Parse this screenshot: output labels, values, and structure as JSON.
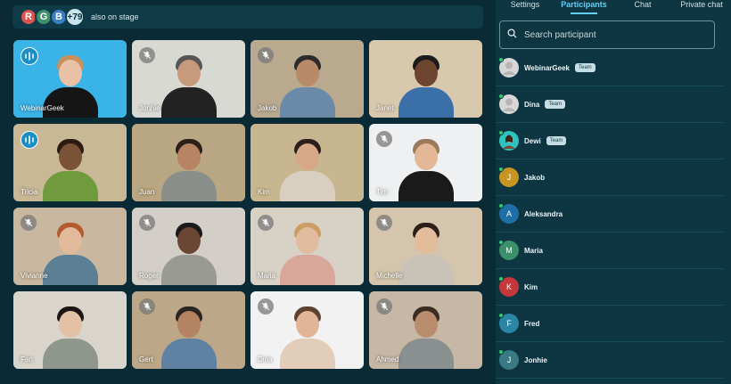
{
  "stage": {
    "avatars": [
      {
        "letter": "R",
        "color": "#d9534f"
      },
      {
        "letter": "G",
        "color": "#3f8f6a"
      },
      {
        "letter": "B",
        "color": "#3a7fc4"
      }
    ],
    "count": "+79",
    "label": "also on stage"
  },
  "tiles": [
    {
      "name": "WebinarGeek",
      "status": "speaking",
      "active": true,
      "bg": "#3ab3e6",
      "skin": "#e9c1a4",
      "hair": "#c7905d",
      "shirt": "#151515"
    },
    {
      "name": "Jonhie",
      "status": "muted",
      "active": false,
      "bg": "#d9d9d4",
      "skin": "#c89a7c",
      "hair": "#555555",
      "shirt": "#222222"
    },
    {
      "name": "Jakob",
      "status": "muted",
      "active": false,
      "bg": "#b8a98f",
      "skin": "#b98a68",
      "hair": "#2b2b2b",
      "shirt": "#6b8aa8"
    },
    {
      "name": "Janet",
      "status": "none",
      "active": false,
      "bg": "#d8c8ae",
      "skin": "#6e4630",
      "hair": "#1b1b1b",
      "shirt": "#3b6fa8"
    },
    {
      "name": "Tricia",
      "status": "speaking",
      "active": true,
      "bg": "#c9b896",
      "skin": "#7a5237",
      "hair": "#2a1c12",
      "shirt": "#6f9b3c"
    },
    {
      "name": "Juan",
      "status": "none",
      "active": false,
      "bg": "#b9a682",
      "skin": "#b88564",
      "hair": "#2a2118",
      "shirt": "#8a8f8c"
    },
    {
      "name": "Kim",
      "status": "none",
      "active": false,
      "bg": "#c8b690",
      "skin": "#d7a886",
      "hair": "#2a1f1a",
      "shirt": "#d9cfc0"
    },
    {
      "name": "Tim",
      "status": "muted",
      "active": false,
      "bg": "#eef0f1",
      "skin": "#e4b897",
      "hair": "#9a7a5a",
      "shirt": "#1a1a1a"
    },
    {
      "name": "Vivianne",
      "status": "muted",
      "active": false,
      "bg": "#c9b7a0",
      "skin": "#e2b99b",
      "hair": "#b35b2f",
      "shirt": "#5d7f96"
    },
    {
      "name": "Roger",
      "status": "muted",
      "active": false,
      "bg": "#d3cfc8",
      "skin": "#6a4634",
      "hair": "#1a1a1a",
      "shirt": "#9a9a95"
    },
    {
      "name": "Maria",
      "status": "muted",
      "active": false,
      "bg": "#d8d2c6",
      "skin": "#e2bc9f",
      "hair": "#c99d63",
      "shirt": "#d9a79a"
    },
    {
      "name": "Michelle",
      "status": "muted",
      "active": false,
      "bg": "#d4c5ac",
      "skin": "#e3bc9c",
      "hair": "#2b2018",
      "shirt": "#c9c2b7"
    },
    {
      "name": "Fan",
      "status": "none",
      "active": true,
      "bg": "#d9d4cc",
      "skin": "#e4c0a4",
      "hair": "#1b1614",
      "shirt": "#8f978d"
    },
    {
      "name": "Gert",
      "status": "muted",
      "active": false,
      "bg": "#bda789",
      "skin": "#b48362",
      "hair": "#2b2521",
      "shirt": "#5f82a3"
    },
    {
      "name": "Dina",
      "status": "muted",
      "active": false,
      "bg": "#f3f2f2",
      "skin": "#e1b597",
      "hair": "#5e4130",
      "shirt": "#e2cdbb"
    },
    {
      "name": "Ahmed",
      "status": "muted",
      "active": false,
      "bg": "#c6b8a4",
      "skin": "#b98c6e",
      "hair": "#3a2c21",
      "shirt": "#8a8f8f"
    }
  ],
  "panel": {
    "tabs": [
      {
        "label": "Settings",
        "active": false
      },
      {
        "label": "Participants",
        "active": true
      },
      {
        "label": "Chat",
        "active": false
      },
      {
        "label": "Private chat",
        "active": false
      }
    ],
    "search_placeholder": "Search participant",
    "participants": [
      {
        "name": "WebinarGeek",
        "badge": "Team",
        "avatar": "photo-grey",
        "letter": "",
        "color": "#d7d7d7"
      },
      {
        "name": "Dina",
        "badge": "Team",
        "avatar": "photo-grey",
        "letter": "",
        "color": "#d7d7d7"
      },
      {
        "name": "Dewi",
        "badge": "Team",
        "avatar": "photo",
        "letter": "",
        "color": "#2fc3c0"
      },
      {
        "name": "Jakob",
        "badge": "",
        "avatar": "letter",
        "letter": "J",
        "color": "#c89422"
      },
      {
        "name": "Aleksandra",
        "badge": "",
        "avatar": "letter",
        "letter": "A",
        "color": "#1f6fa6"
      },
      {
        "name": "Maria",
        "badge": "",
        "avatar": "letter",
        "letter": "M",
        "color": "#3c8f6b"
      },
      {
        "name": "Kim",
        "badge": "",
        "avatar": "letter",
        "letter": "K",
        "color": "#c4383b"
      },
      {
        "name": "Fred",
        "badge": "",
        "avatar": "letter",
        "letter": "F",
        "color": "#2b86a5"
      },
      {
        "name": "Jonhie",
        "badge": "",
        "avatar": "letter",
        "letter": "J",
        "color": "#3a7a86"
      }
    ]
  }
}
